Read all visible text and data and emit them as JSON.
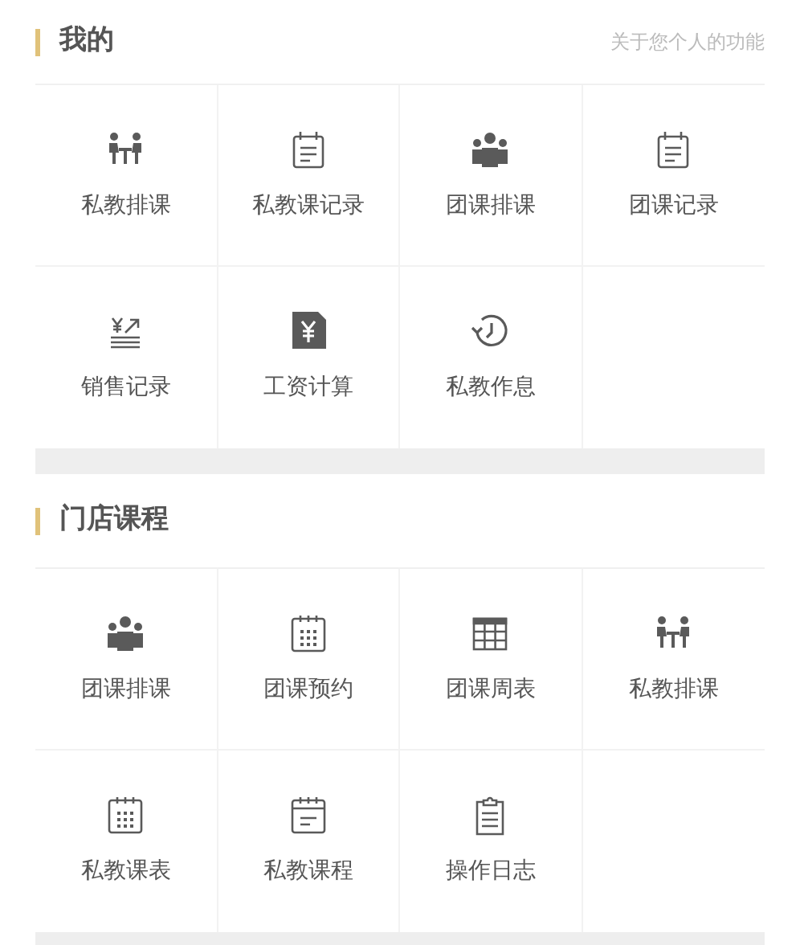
{
  "sections": [
    {
      "title": "我的",
      "subtitle": "关于您个人的功能",
      "items": [
        {
          "label": "私教排课",
          "kind": "meeting"
        },
        {
          "label": "私教课记录",
          "kind": "notepad"
        },
        {
          "label": "团课排课",
          "kind": "group"
        },
        {
          "label": "团课记录",
          "kind": "notepad"
        },
        {
          "label": "销售记录",
          "kind": "sales"
        },
        {
          "label": "工资计算",
          "kind": "salary"
        },
        {
          "label": "私教作息",
          "kind": "clock"
        }
      ]
    },
    {
      "title": "门店课程",
      "items": [
        {
          "label": "团课排课",
          "kind": "group"
        },
        {
          "label": "团课预约",
          "kind": "calendar"
        },
        {
          "label": "团课周表",
          "kind": "table"
        },
        {
          "label": "私教排课",
          "kind": "meeting"
        },
        {
          "label": "私教课表",
          "kind": "calendar"
        },
        {
          "label": "私教课程",
          "kind": "schedule"
        },
        {
          "label": "操作日志",
          "kind": "clipboard"
        }
      ]
    }
  ]
}
